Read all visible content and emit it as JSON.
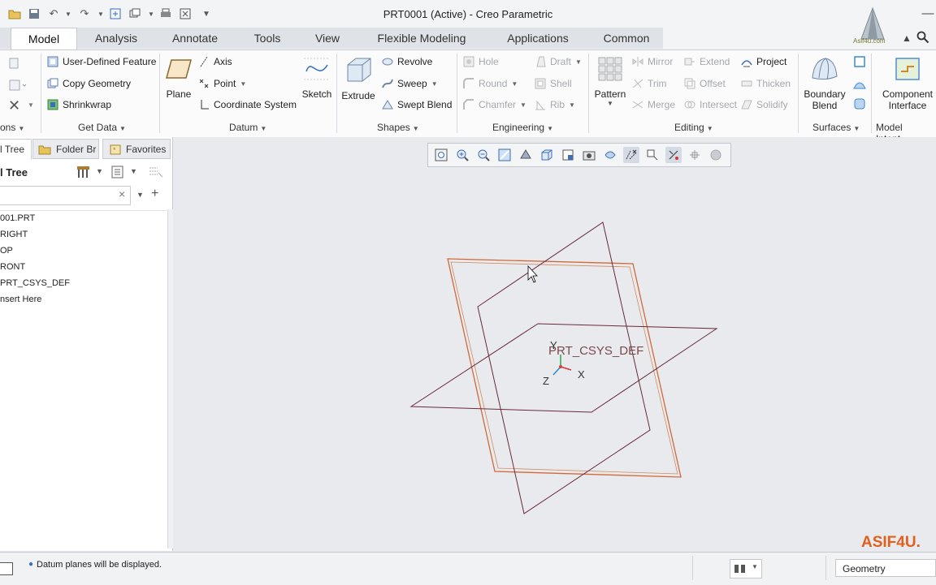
{
  "window": {
    "title": "PRT0001 (Active) - Creo Parametric"
  },
  "tabs": [
    "Model",
    "Analysis",
    "Annotate",
    "Tools",
    "View",
    "Flexible Modeling",
    "Applications",
    "Common"
  ],
  "ribbon": {
    "get_data": {
      "user_defined_feature": "User-Defined Feature",
      "copy_geometry": "Copy Geometry",
      "shrinkwrap": "Shrinkwrap",
      "label": "Get Data"
    },
    "operations_label": "ons",
    "datum": {
      "plane": "Plane",
      "axis": "Axis",
      "point": "Point",
      "coordinate_system": "Coordinate System",
      "sketch": "Sketch",
      "label": "Datum"
    },
    "shapes": {
      "extrude": "Extrude",
      "revolve": "Revolve",
      "sweep": "Sweep",
      "swept_blend": "Swept Blend",
      "label": "Shapes"
    },
    "engineering": {
      "hole": "Hole",
      "draft": "Draft",
      "round": "Round",
      "shell": "Shell",
      "chamfer": "Chamfer",
      "rib": "Rib",
      "label": "Engineering"
    },
    "editing": {
      "pattern": "Pattern",
      "mirror": "Mirror",
      "extend": "Extend",
      "project": "Project",
      "trim": "Trim",
      "offset": "Offset",
      "thicken": "Thicken",
      "merge": "Merge",
      "intersect": "Intersect",
      "solidify": "Solidify",
      "label": "Editing"
    },
    "surfaces": {
      "boundary_blend_1": "Boundary",
      "boundary_blend_2": "Blend",
      "label": "Surfaces"
    },
    "model_intent": {
      "component_interface_1": "Component",
      "component_interface_2": "Interface",
      "label": "Model Intent"
    }
  },
  "left_panel": {
    "tabs": [
      "l Tree",
      "Folder Br",
      "Favorites"
    ],
    "header": "l Tree",
    "tree": [
      "001.PRT",
      "RIGHT",
      "OP",
      "RONT",
      "PRT_CSYS_DEF",
      "nsert Here"
    ]
  },
  "graphics": {
    "csys_label": "PRT_CSYS_DEF",
    "axis_x": "X",
    "axis_y": "Y",
    "axis_z": "Z"
  },
  "status": {
    "message": "Datum planes will be displayed.",
    "filter": "Geometry"
  },
  "watermark": "ASIF4U.",
  "logo_text": "Asif4u.com"
}
